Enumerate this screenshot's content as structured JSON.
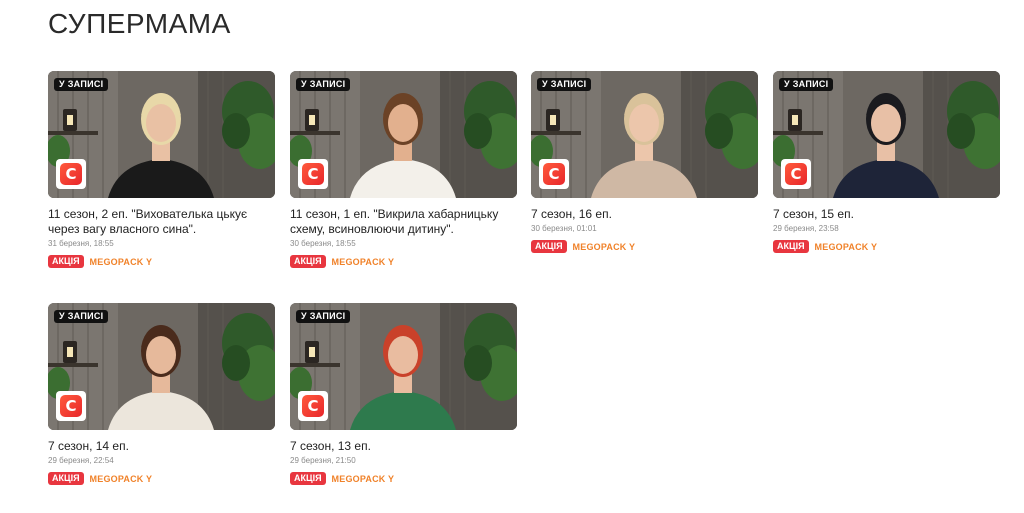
{
  "page": {
    "title": "СУПЕРМАМА"
  },
  "badge_label": "У ЗАПИСІ",
  "channel_logo_letter": "С",
  "tags": {
    "sale": "АКЦІЯ",
    "pack": "MEGOPACK Y"
  },
  "colors": {
    "sale_bg": "#e8363f",
    "pack_text": "#f0822a",
    "logo_red": "#e8262b"
  },
  "episodes": [
    {
      "title": "11 сезон, 2 еп. \"Виховатeлька цькує через вагу власного сина\".",
      "date": "31 березня, 18:55",
      "hair": "#e8d8a8",
      "outfit": "#1a1a1a",
      "skin": "#e9c1a4"
    },
    {
      "title": "11 сезон, 1 еп. \"Викрила хабарницьку схему, всиновлюючи дитину\".",
      "date": "30 березня, 18:55",
      "hair": "#6b4226",
      "outfit": "#f3f0ea",
      "skin": "#e2b08e"
    },
    {
      "title": "7 сезон, 16 еп.",
      "date": "30 березня, 01:01",
      "hair": "#d9c29a",
      "outfit": "#cfb8a4",
      "skin": "#ecc6ab"
    },
    {
      "title": "7 сезон, 15 еп.",
      "date": "29 березня, 23:58",
      "hair": "#1b1b1f",
      "outfit": "#1e2438",
      "skin": "#e8c0a6"
    },
    {
      "title": "7 сезон, 14 еп.",
      "date": "29 березня, 22:54",
      "hair": "#4a2b1c",
      "outfit": "#ece6dc",
      "skin": "#e6b99b"
    },
    {
      "title": "7 сезон, 13 еп.",
      "date": "29 березня, 21:50",
      "hair": "#c9412a",
      "outfit": "#2e7a4d",
      "skin": "#e9bca0"
    }
  ]
}
